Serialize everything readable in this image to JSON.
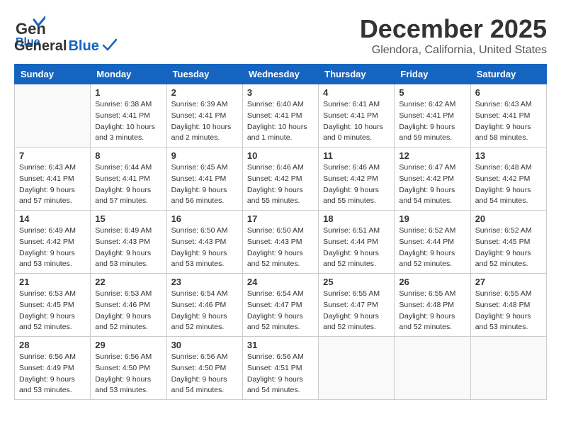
{
  "header": {
    "logo_general": "General",
    "logo_blue": "Blue",
    "month": "December 2025",
    "location": "Glendora, California, United States"
  },
  "days_of_week": [
    "Sunday",
    "Monday",
    "Tuesday",
    "Wednesday",
    "Thursday",
    "Friday",
    "Saturday"
  ],
  "weeks": [
    [
      {
        "day": "",
        "sunrise": "",
        "sunset": "",
        "daylight": ""
      },
      {
        "day": "1",
        "sunrise": "Sunrise: 6:38 AM",
        "sunset": "Sunset: 4:41 PM",
        "daylight": "Daylight: 10 hours and 3 minutes."
      },
      {
        "day": "2",
        "sunrise": "Sunrise: 6:39 AM",
        "sunset": "Sunset: 4:41 PM",
        "daylight": "Daylight: 10 hours and 2 minutes."
      },
      {
        "day": "3",
        "sunrise": "Sunrise: 6:40 AM",
        "sunset": "Sunset: 4:41 PM",
        "daylight": "Daylight: 10 hours and 1 minute."
      },
      {
        "day": "4",
        "sunrise": "Sunrise: 6:41 AM",
        "sunset": "Sunset: 4:41 PM",
        "daylight": "Daylight: 10 hours and 0 minutes."
      },
      {
        "day": "5",
        "sunrise": "Sunrise: 6:42 AM",
        "sunset": "Sunset: 4:41 PM",
        "daylight": "Daylight: 9 hours and 59 minutes."
      },
      {
        "day": "6",
        "sunrise": "Sunrise: 6:43 AM",
        "sunset": "Sunset: 4:41 PM",
        "daylight": "Daylight: 9 hours and 58 minutes."
      }
    ],
    [
      {
        "day": "7",
        "sunrise": "Sunrise: 6:43 AM",
        "sunset": "Sunset: 4:41 PM",
        "daylight": "Daylight: 9 hours and 57 minutes."
      },
      {
        "day": "8",
        "sunrise": "Sunrise: 6:44 AM",
        "sunset": "Sunset: 4:41 PM",
        "daylight": "Daylight: 9 hours and 57 minutes."
      },
      {
        "day": "9",
        "sunrise": "Sunrise: 6:45 AM",
        "sunset": "Sunset: 4:41 PM",
        "daylight": "Daylight: 9 hours and 56 minutes."
      },
      {
        "day": "10",
        "sunrise": "Sunrise: 6:46 AM",
        "sunset": "Sunset: 4:42 PM",
        "daylight": "Daylight: 9 hours and 55 minutes."
      },
      {
        "day": "11",
        "sunrise": "Sunrise: 6:46 AM",
        "sunset": "Sunset: 4:42 PM",
        "daylight": "Daylight: 9 hours and 55 minutes."
      },
      {
        "day": "12",
        "sunrise": "Sunrise: 6:47 AM",
        "sunset": "Sunset: 4:42 PM",
        "daylight": "Daylight: 9 hours and 54 minutes."
      },
      {
        "day": "13",
        "sunrise": "Sunrise: 6:48 AM",
        "sunset": "Sunset: 4:42 PM",
        "daylight": "Daylight: 9 hours and 54 minutes."
      }
    ],
    [
      {
        "day": "14",
        "sunrise": "Sunrise: 6:49 AM",
        "sunset": "Sunset: 4:42 PM",
        "daylight": "Daylight: 9 hours and 53 minutes."
      },
      {
        "day": "15",
        "sunrise": "Sunrise: 6:49 AM",
        "sunset": "Sunset: 4:43 PM",
        "daylight": "Daylight: 9 hours and 53 minutes."
      },
      {
        "day": "16",
        "sunrise": "Sunrise: 6:50 AM",
        "sunset": "Sunset: 4:43 PM",
        "daylight": "Daylight: 9 hours and 53 minutes."
      },
      {
        "day": "17",
        "sunrise": "Sunrise: 6:50 AM",
        "sunset": "Sunset: 4:43 PM",
        "daylight": "Daylight: 9 hours and 52 minutes."
      },
      {
        "day": "18",
        "sunrise": "Sunrise: 6:51 AM",
        "sunset": "Sunset: 4:44 PM",
        "daylight": "Daylight: 9 hours and 52 minutes."
      },
      {
        "day": "19",
        "sunrise": "Sunrise: 6:52 AM",
        "sunset": "Sunset: 4:44 PM",
        "daylight": "Daylight: 9 hours and 52 minutes."
      },
      {
        "day": "20",
        "sunrise": "Sunrise: 6:52 AM",
        "sunset": "Sunset: 4:45 PM",
        "daylight": "Daylight: 9 hours and 52 minutes."
      }
    ],
    [
      {
        "day": "21",
        "sunrise": "Sunrise: 6:53 AM",
        "sunset": "Sunset: 4:45 PM",
        "daylight": "Daylight: 9 hours and 52 minutes."
      },
      {
        "day": "22",
        "sunrise": "Sunrise: 6:53 AM",
        "sunset": "Sunset: 4:46 PM",
        "daylight": "Daylight: 9 hours and 52 minutes."
      },
      {
        "day": "23",
        "sunrise": "Sunrise: 6:54 AM",
        "sunset": "Sunset: 4:46 PM",
        "daylight": "Daylight: 9 hours and 52 minutes."
      },
      {
        "day": "24",
        "sunrise": "Sunrise: 6:54 AM",
        "sunset": "Sunset: 4:47 PM",
        "daylight": "Daylight: 9 hours and 52 minutes."
      },
      {
        "day": "25",
        "sunrise": "Sunrise: 6:55 AM",
        "sunset": "Sunset: 4:47 PM",
        "daylight": "Daylight: 9 hours and 52 minutes."
      },
      {
        "day": "26",
        "sunrise": "Sunrise: 6:55 AM",
        "sunset": "Sunset: 4:48 PM",
        "daylight": "Daylight: 9 hours and 52 minutes."
      },
      {
        "day": "27",
        "sunrise": "Sunrise: 6:55 AM",
        "sunset": "Sunset: 4:48 PM",
        "daylight": "Daylight: 9 hours and 53 minutes."
      }
    ],
    [
      {
        "day": "28",
        "sunrise": "Sunrise: 6:56 AM",
        "sunset": "Sunset: 4:49 PM",
        "daylight": "Daylight: 9 hours and 53 minutes."
      },
      {
        "day": "29",
        "sunrise": "Sunrise: 6:56 AM",
        "sunset": "Sunset: 4:50 PM",
        "daylight": "Daylight: 9 hours and 53 minutes."
      },
      {
        "day": "30",
        "sunrise": "Sunrise: 6:56 AM",
        "sunset": "Sunset: 4:50 PM",
        "daylight": "Daylight: 9 hours and 54 minutes."
      },
      {
        "day": "31",
        "sunrise": "Sunrise: 6:56 AM",
        "sunset": "Sunset: 4:51 PM",
        "daylight": "Daylight: 9 hours and 54 minutes."
      },
      {
        "day": "",
        "sunrise": "",
        "sunset": "",
        "daylight": ""
      },
      {
        "day": "",
        "sunrise": "",
        "sunset": "",
        "daylight": ""
      },
      {
        "day": "",
        "sunrise": "",
        "sunset": "",
        "daylight": ""
      }
    ]
  ]
}
